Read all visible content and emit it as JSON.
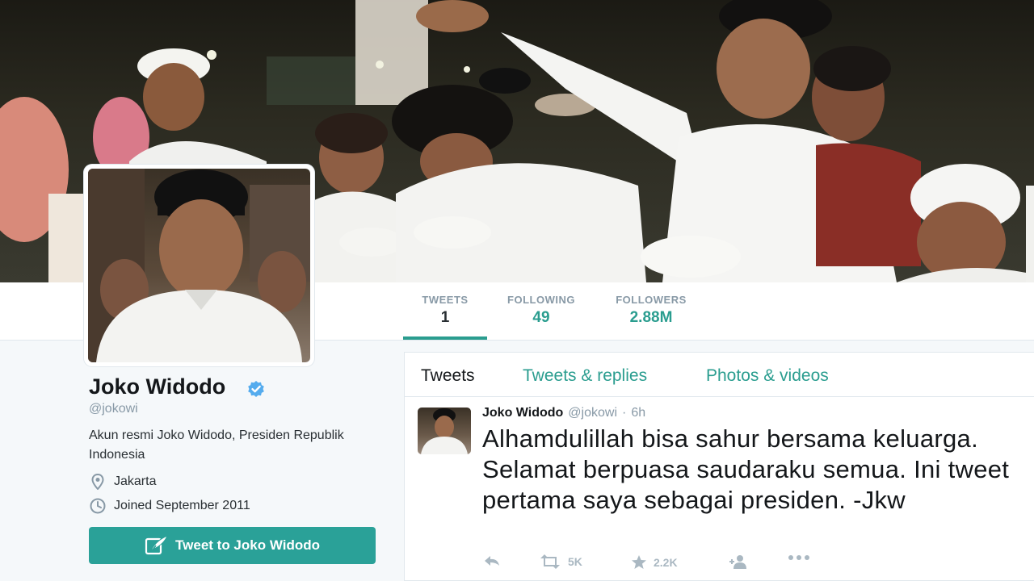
{
  "profile": {
    "name": "Joko Widodo",
    "handle": "@jokowi",
    "bio": "Akun resmi Joko Widodo, Presiden Republik Indonesia",
    "location": "Jakarta",
    "joined": "Joined September 2011",
    "tweet_to_label": "Tweet to Joko Widodo",
    "verified": true
  },
  "stats": [
    {
      "label": "TWEETS",
      "value": "1"
    },
    {
      "label": "FOLLOWING",
      "value": "49"
    },
    {
      "label": "FOLLOWERS",
      "value": "2.88M"
    }
  ],
  "tabs": [
    {
      "label": "Tweets"
    },
    {
      "label": "Tweets & replies"
    },
    {
      "label": "Photos & videos"
    }
  ],
  "tweet": {
    "name": "Joko Widodo",
    "handle": "@jokowi",
    "sep": "·",
    "time": "6h",
    "text": "Alhamdulillah bisa sahur bersama keluarga. Selamat berpuasa saudaraku semua. Ini tweet pertama saya sebagai presiden. -Jkw",
    "retweets": "5K",
    "favorites": "2.2K"
  },
  "colors": {
    "accent": "#2a9d8f",
    "button": "#2aa198",
    "muted": "#8899a6",
    "verified": "#55acee"
  },
  "icons": [
    "verified-badge-icon",
    "location-pin-icon",
    "clock-icon",
    "quill-icon",
    "reply-icon",
    "retweet-icon",
    "star-icon",
    "follow-icon",
    "more-icon"
  ]
}
